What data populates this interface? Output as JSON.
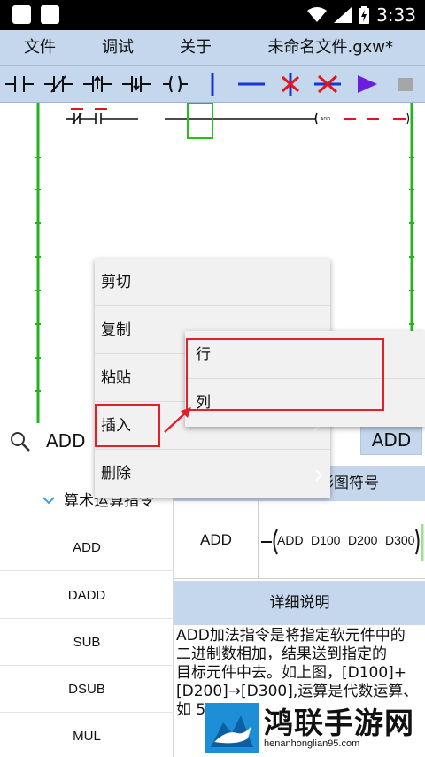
{
  "status_bar": {
    "time": "3:33"
  },
  "menu": {
    "file": "文件",
    "debug": "调试",
    "about": "关于",
    "filename": "未命名文件.gxw*"
  },
  "toolbar": {
    "icons": [
      "normally-open-contact-icon",
      "normally-closed-contact-icon",
      "rising-edge-contact-icon",
      "falling-edge-contact-icon",
      "coil-icon",
      "vertical-line-icon",
      "horizontal-line-icon",
      "delete-vertical-line-icon",
      "delete-horizontal-line-icon",
      "run-icon",
      "stop-icon"
    ],
    "colors": {
      "blue": "#1536d6",
      "red": "#e2171c",
      "violet": "#6c1ee0",
      "gray": "#a6a6a6"
    }
  },
  "ladder": {
    "instruction": "ADD",
    "operand_color": "#e2171c",
    "rail_color": "#22b51b"
  },
  "search": {
    "query": "ADD",
    "button_label": "ADD"
  },
  "tree": {
    "category": "算术运算指令",
    "items": [
      "ADD",
      "DADD",
      "SUB",
      "DSUB",
      "MUL"
    ]
  },
  "detail": {
    "symbol_header": "梯形图符号",
    "instruction": "ADD",
    "symbol": {
      "op": "ADD",
      "s1": "D100",
      "s2": "D200",
      "d": "D300"
    },
    "desc_header": "详细说明",
    "desc_lines": [
      "ADD加法指令是将指定软元件中的",
      "二进制数相加，结果送到指定的",
      "目标元件中去。如上图，[D100]+",
      "[D200]→[D300],运算是代数运算、",
      "如 5"
    ]
  },
  "context_menu": {
    "items": [
      "剪切",
      "复制",
      "粘贴",
      "插入",
      "删除"
    ],
    "submenu": [
      "行",
      "列"
    ]
  },
  "watermark": {
    "title": "鸿联手游网",
    "url": "henanhonglian95.com"
  }
}
